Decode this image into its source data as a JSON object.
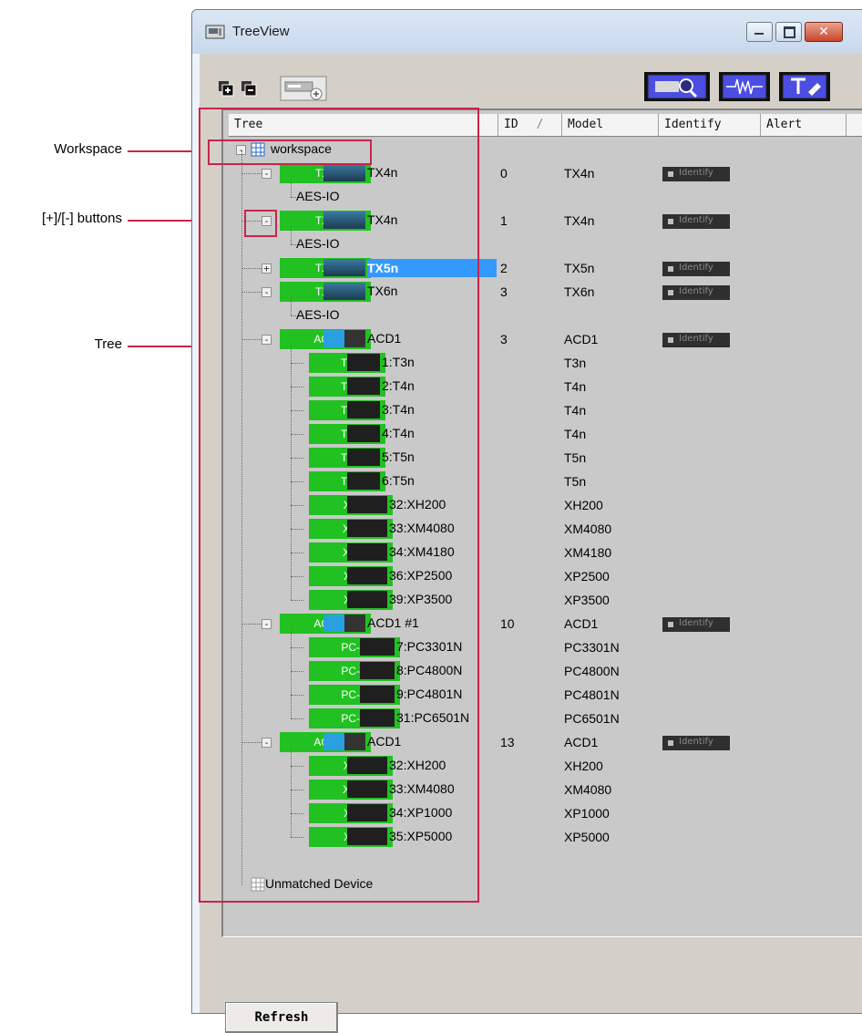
{
  "window": {
    "title": "TreeView"
  },
  "callouts": [
    {
      "label": "Workspace"
    },
    {
      "label": "[+]/[-] buttons"
    },
    {
      "label": "Tree"
    }
  ],
  "columns": [
    "Tree",
    "ID",
    "/",
    "Model",
    "Identify",
    "Alert"
  ],
  "root": {
    "label": "workspace"
  },
  "identify_label": "Identify",
  "rows": [
    {
      "tag": "TXn",
      "name": "TX4n",
      "id": "0",
      "model": "TX4n",
      "identify": true,
      "toggle": "-",
      "level": 1
    },
    {
      "tag": "",
      "name": "AES-IO",
      "id": "",
      "model": "",
      "identify": false,
      "toggle": "",
      "level": 2
    },
    {
      "tag": "TXn",
      "name": "TX4n",
      "id": "1",
      "model": "TX4n",
      "identify": true,
      "toggle": "-",
      "level": 1
    },
    {
      "tag": "",
      "name": "AES-IO",
      "id": "",
      "model": "",
      "identify": false,
      "toggle": "",
      "level": 2
    },
    {
      "tag": "TXn",
      "name": "TX5n",
      "id": "2",
      "model": "TX5n",
      "identify": true,
      "toggle": "+",
      "level": 1,
      "selected": true
    },
    {
      "tag": "TXn",
      "name": "TX6n",
      "id": "3",
      "model": "TX6n",
      "identify": true,
      "toggle": "-",
      "level": 1
    },
    {
      "tag": "",
      "name": "AES-IO",
      "id": "",
      "model": "",
      "identify": false,
      "toggle": "",
      "level": 2
    },
    {
      "tag": "ACD",
      "name": "ACD1",
      "id": "3",
      "model": "ACD1",
      "identify": true,
      "toggle": "-",
      "level": 1
    },
    {
      "tag": "Tn",
      "name": "1:T3n",
      "id": "",
      "model": "T3n",
      "identify": false,
      "toggle": "",
      "level": 2
    },
    {
      "tag": "Tn",
      "name": "2:T4n",
      "id": "",
      "model": "T4n",
      "identify": false,
      "toggle": "",
      "level": 2
    },
    {
      "tag": "Tn",
      "name": "3:T4n",
      "id": "",
      "model": "T4n",
      "identify": false,
      "toggle": "",
      "level": 2
    },
    {
      "tag": "Tn",
      "name": "4:T4n",
      "id": "",
      "model": "T4n",
      "identify": false,
      "toggle": "",
      "level": 2
    },
    {
      "tag": "Tn",
      "name": "5:T5n",
      "id": "",
      "model": "T5n",
      "identify": false,
      "toggle": "",
      "level": 2
    },
    {
      "tag": "Tn",
      "name": "6:T5n",
      "id": "",
      "model": "T5n",
      "identify": false,
      "toggle": "",
      "level": 2
    },
    {
      "tag": "XH",
      "name": "32:XH200",
      "id": "",
      "model": "XH200",
      "identify": false,
      "toggle": "",
      "level": 2
    },
    {
      "tag": "XM",
      "name": "33:XM4080",
      "id": "",
      "model": "XM4080",
      "identify": false,
      "toggle": "",
      "level": 2
    },
    {
      "tag": "XM",
      "name": "34:XM4180",
      "id": "",
      "model": "XM4180",
      "identify": false,
      "toggle": "",
      "level": 2
    },
    {
      "tag": "XP",
      "name": "36:XP2500",
      "id": "",
      "model": "XP2500",
      "identify": false,
      "toggle": "",
      "level": 2
    },
    {
      "tag": "XP",
      "name": "39:XP3500",
      "id": "",
      "model": "XP3500",
      "identify": false,
      "toggle": "",
      "level": 2
    },
    {
      "tag": "ACD",
      "name": "ACD1 #1",
      "id": "10",
      "model": "ACD1",
      "identify": true,
      "toggle": "-",
      "level": 1
    },
    {
      "tag": "PC-N",
      "name": "7:PC3301N",
      "id": "",
      "model": "PC3301N",
      "identify": false,
      "toggle": "",
      "level": 2
    },
    {
      "tag": "PC-N",
      "name": "8:PC4800N",
      "id": "",
      "model": "PC4800N",
      "identify": false,
      "toggle": "",
      "level": 2
    },
    {
      "tag": "PC-N",
      "name": "9:PC4801N",
      "id": "",
      "model": "PC4801N",
      "identify": false,
      "toggle": "",
      "level": 2
    },
    {
      "tag": "PC-N",
      "name": "31:PC6501N",
      "id": "",
      "model": "PC6501N",
      "identify": false,
      "toggle": "",
      "level": 2
    },
    {
      "tag": "ACD",
      "name": "ACD1",
      "id": "13",
      "model": "ACD1",
      "identify": true,
      "toggle": "-",
      "level": 1
    },
    {
      "tag": "XH",
      "name": "32:XH200",
      "id": "",
      "model": "XH200",
      "identify": false,
      "toggle": "",
      "level": 2
    },
    {
      "tag": "XM",
      "name": "33:XM4080",
      "id": "",
      "model": "XM4080",
      "identify": false,
      "toggle": "",
      "level": 2
    },
    {
      "tag": "XP",
      "name": "34:XP1000",
      "id": "",
      "model": "XP1000",
      "identify": false,
      "toggle": "",
      "level": 2
    },
    {
      "tag": "XP",
      "name": "35:XP5000",
      "id": "",
      "model": "XP5000",
      "identify": false,
      "toggle": "",
      "level": 2
    }
  ],
  "unmatched": {
    "label": "Unmatched Device"
  },
  "refresh_label": "Refresh",
  "colors": {
    "callout": "#c8254a",
    "tag": "#22c122",
    "selected": "#3399ff"
  }
}
